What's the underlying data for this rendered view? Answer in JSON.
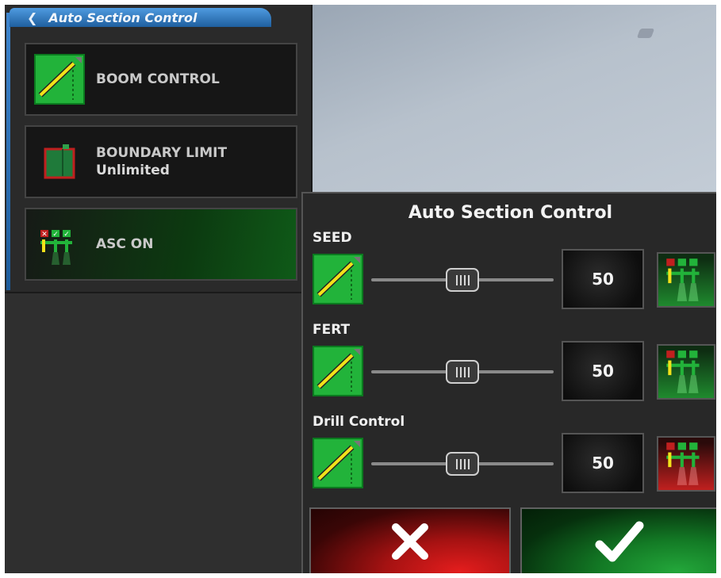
{
  "panel": {
    "back_glyph": "❮",
    "title": "Auto Section Control",
    "items": [
      {
        "label": "BOOM CONTROL",
        "sub": "",
        "icon": "boom-control-icon"
      },
      {
        "label": "BOUNDARY LIMIT",
        "sub": "Unlimited",
        "icon": "boundary-limit-icon"
      },
      {
        "label": "ASC ON",
        "sub": "",
        "icon": "asc-status-icon"
      }
    ]
  },
  "dialog": {
    "title": "Auto Section Control",
    "rows": [
      {
        "label": "SEED",
        "value": "50",
        "slider_fraction": 0.5,
        "asc_state": "green"
      },
      {
        "label": "FERT",
        "value": "50",
        "slider_fraction": 0.5,
        "asc_state": "green"
      },
      {
        "label": "Drill Control",
        "value": "50",
        "slider_fraction": 0.5,
        "asc_state": "red"
      }
    ],
    "cancel_icon": "close-icon",
    "confirm_icon": "checkmark-icon"
  },
  "colors": {
    "accent_blue": "#3f86cf",
    "active_green": "#22b33a",
    "cancel_red": "#c0201f",
    "confirm_green": "#1f8a2e"
  }
}
